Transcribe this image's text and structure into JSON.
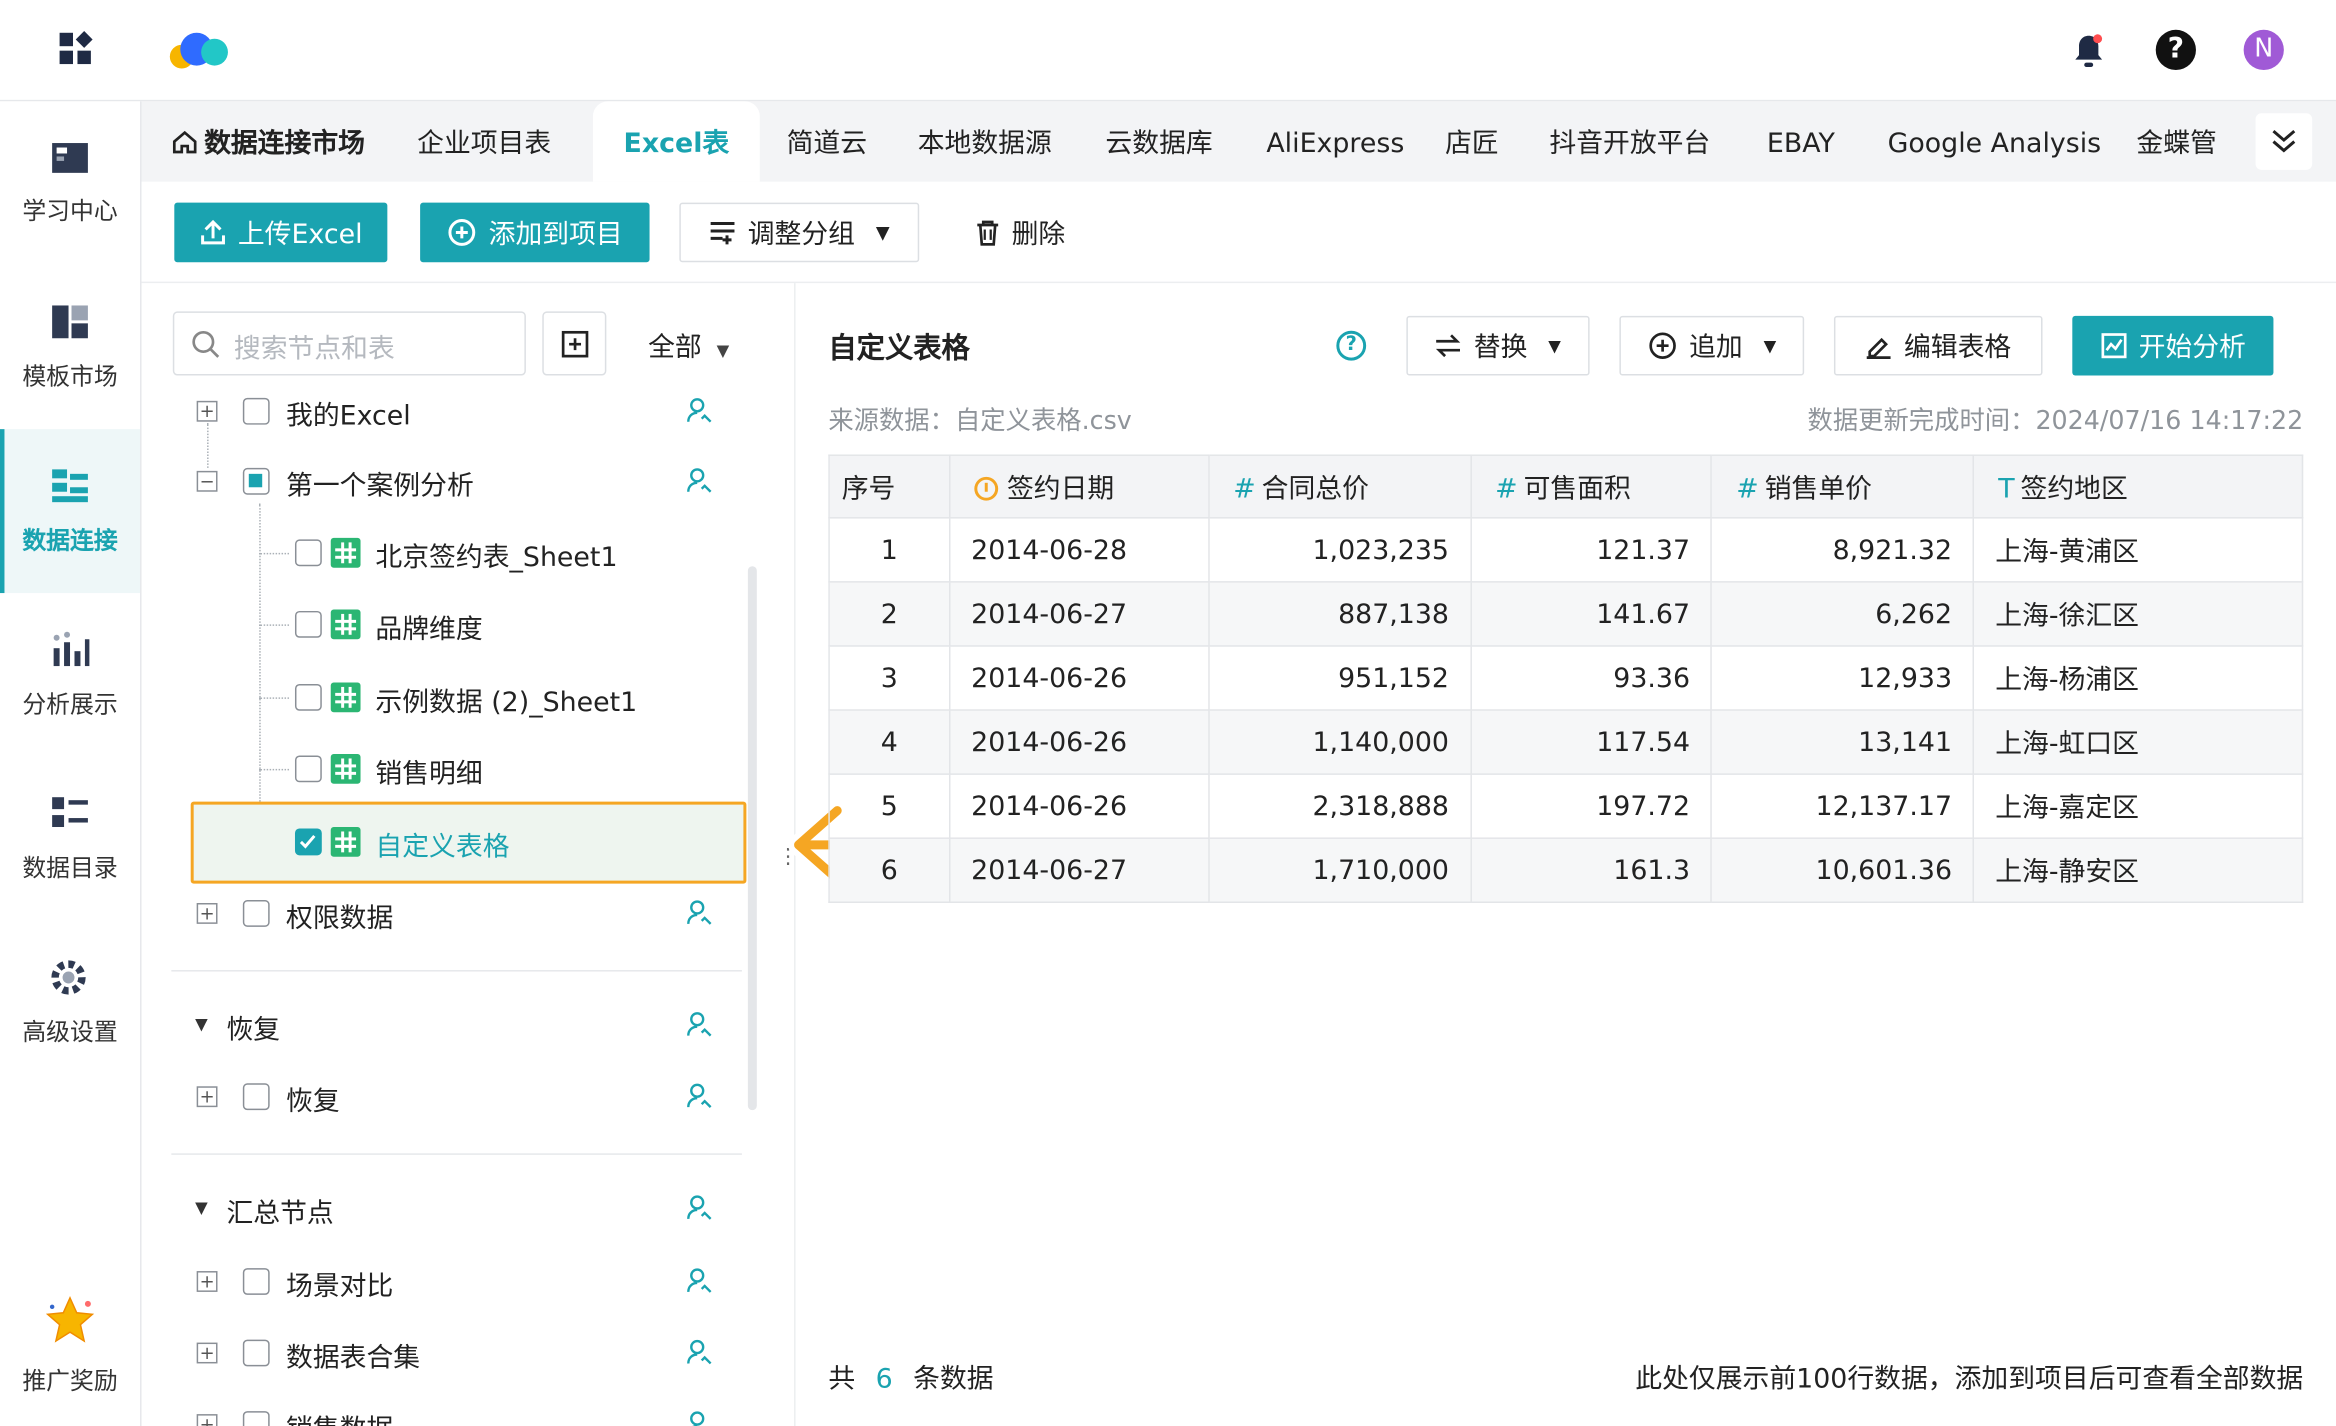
{
  "app": {
    "brand_colors": {
      "accent": "#1aa3b0",
      "highlight": "#f5a623"
    }
  },
  "topbar": {
    "avatar_letter": "N",
    "icons": [
      "apps-grid-icon",
      "logo-cloud-icon",
      "bell-icon",
      "help-icon"
    ]
  },
  "leftnav": {
    "items": [
      {
        "label": "学习中心",
        "icon": "book-icon"
      },
      {
        "label": "模板市场",
        "icon": "template-icon"
      },
      {
        "label": "数据连接",
        "icon": "data-connect-icon",
        "active": true
      },
      {
        "label": "分析展示",
        "icon": "chart-icon"
      },
      {
        "label": "数据目录",
        "icon": "catalog-icon"
      },
      {
        "label": "高级设置",
        "icon": "gear-icon"
      },
      {
        "label": "推广奖励",
        "icon": "star-icon"
      }
    ]
  },
  "tabs": {
    "home": "数据连接市场",
    "items": [
      "企业项目表",
      "Excel表",
      "简道云",
      "本地数据源",
      "云数据库",
      "AliExpress",
      "店匠",
      "抖音开放平台",
      "EBAY",
      "Google Analysis",
      "金蝶管"
    ],
    "active": "Excel表"
  },
  "toolbar": {
    "upload": "上传Excel",
    "add_to_project": "添加到项目",
    "adjust_group": "调整分组",
    "delete": "删除"
  },
  "tree": {
    "search_placeholder": "搜索节点和表",
    "filter": "全部",
    "partial_top": "我的Excel",
    "group1": "第一个案例分析",
    "children": [
      "北京签约表_Sheet1",
      "品牌维度",
      "示例数据 (2)_Sheet1",
      "销售明细",
      "自定义表格"
    ],
    "perm": "权限数据",
    "section_restore": "恢复",
    "restore_item": "恢复",
    "section_summary": "汇总节点",
    "summary_items": [
      "场景对比",
      "数据表合集",
      "销售数据"
    ]
  },
  "panel": {
    "title": "自定义表格",
    "replace": "替换",
    "append": "追加",
    "edit_table": "编辑表格",
    "start_analysis": "开始分析",
    "source": "来源数据：自定义表格.csv",
    "updated": "数据更新完成时间：2024/07/16 14:17:22"
  },
  "table": {
    "columns": [
      {
        "type": "",
        "name": "序号"
      },
      {
        "type": "date",
        "name": "签约日期"
      },
      {
        "type": "#",
        "name": "合同总价"
      },
      {
        "type": "#",
        "name": "可售面积"
      },
      {
        "type": "#",
        "name": "销售单价"
      },
      {
        "type": "T",
        "name": "签约地区"
      }
    ],
    "rows": [
      [
        "1",
        "2014-06-28",
        "1,023,235",
        "121.37",
        "8,921.32",
        "上海-黄浦区"
      ],
      [
        "2",
        "2014-06-27",
        "887,138",
        "141.67",
        "6,262",
        "上海-徐汇区"
      ],
      [
        "3",
        "2014-06-26",
        "951,152",
        "93.36",
        "12,933",
        "上海-杨浦区"
      ],
      [
        "4",
        "2014-06-26",
        "1,140,000",
        "117.54",
        "13,141",
        "上海-虹口区"
      ],
      [
        "5",
        "2014-06-26",
        "2,318,888",
        "197.72",
        "12,137.17",
        "上海-嘉定区"
      ],
      [
        "6",
        "2014-06-27",
        "1,710,000",
        "161.3",
        "10,601.36",
        "上海-静安区"
      ]
    ]
  },
  "footer": {
    "count_prefix": "共",
    "count": "6",
    "count_suffix": "条数据",
    "note": "此处仅展示前100行数据，添加到项目后可查看全部数据"
  }
}
